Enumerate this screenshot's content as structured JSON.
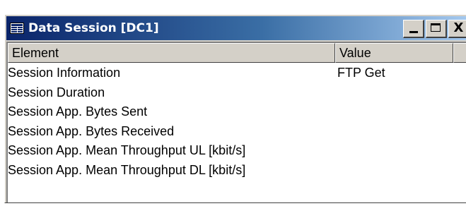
{
  "window": {
    "title": "Data Session [DC1]",
    "icon": "table-window-icon",
    "buttons": {
      "minimize": "minimize-icon",
      "maximize": "maximize-icon",
      "close": "X"
    }
  },
  "table": {
    "columns": [
      "Element",
      "Value"
    ],
    "rows": [
      {
        "element": "Session Information",
        "value": "FTP Get"
      },
      {
        "element": "Session Duration",
        "value": ""
      },
      {
        "element": "Session App. Bytes Sent",
        "value": ""
      },
      {
        "element": "Session App. Bytes Received",
        "value": ""
      },
      {
        "element": "Session App. Mean Throughput UL [kbit/s]",
        "value": ""
      },
      {
        "element": "Session App. Mean Throughput DL [kbit/s]",
        "value": ""
      }
    ]
  },
  "colors": {
    "titlebar_start": "#0a246a",
    "titlebar_end": "#a6caf0",
    "face": "#d4d0c8"
  }
}
